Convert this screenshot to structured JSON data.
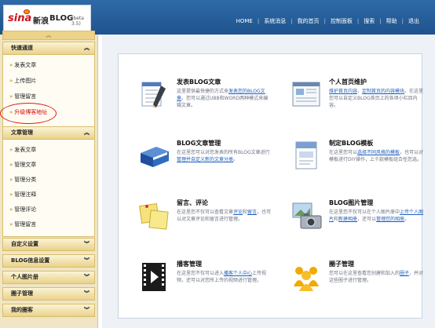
{
  "header": {
    "logo": {
      "sina": "sina",
      "xinlang": "新浪",
      "blog": "BLOG",
      "beta": "(beta 3.5)"
    },
    "nav": [
      "HOME",
      "系统消息",
      "我的首页",
      "控制面板",
      "搜索",
      "帮助",
      "退出"
    ]
  },
  "sidebar": {
    "collapse_glyph": "︽",
    "sections": [
      {
        "title": "快速通道",
        "items": [
          "发表文章",
          "上传图片",
          "管理留言",
          "升级博客地址"
        ]
      },
      {
        "title": "文章管理",
        "items": [
          "发表文章",
          "管理文章",
          "管理分类",
          "管理注释",
          "管理评论",
          "管理留言"
        ]
      },
      {
        "title": "自定义设置"
      },
      {
        "title": "BLOG信息设置"
      },
      {
        "title": "个人图片册"
      },
      {
        "title": "圈子管理"
      },
      {
        "title": "我的圈客"
      }
    ]
  },
  "features": [
    {
      "title": "发表BLOG文章",
      "desc_parts": [
        {
          "t": "这里提供最快捷的方式来"
        },
        {
          "t": "发表您的BLOG文章",
          "link": true
        },
        {
          "t": "。您可以通过UBB和WORD两种模式来编辑文章。"
        }
      ]
    },
    {
      "title": "个人首页维护",
      "desc_parts": [
        {
          "t": "维护首页内容",
          "link": true
        },
        {
          "t": "，"
        },
        {
          "t": "定制首页的内容模块",
          "link": true
        },
        {
          "t": "。在这里您可以自定义BLOG首页上的各项小栏目内容。"
        }
      ]
    },
    {
      "title": "BLOG文章管理",
      "desc_parts": [
        {
          "t": "在这里您可以对您发表的所有BLOG文章进行"
        },
        {
          "t": "管理并自定义新的文章分类",
          "link": true
        },
        {
          "t": "。"
        }
      ]
    },
    {
      "title": "制定BLOG模板",
      "desc_parts": [
        {
          "t": "在这里您可以"
        },
        {
          "t": "选择不同风格的模板",
          "link": true
        },
        {
          "t": "，也可以对模板进行DIY操作，上千款模板组合任您选。"
        }
      ]
    },
    {
      "title": "留言、评论",
      "desc_parts": [
        {
          "t": "在这里您不仅可以查看文章"
        },
        {
          "t": "评论",
          "link": true
        },
        {
          "t": "和"
        },
        {
          "t": "留言",
          "link": true
        },
        {
          "t": "，也可以对文章评论和留言进行管理。"
        }
      ]
    },
    {
      "title": "BLOG图片管理",
      "desc_parts": [
        {
          "t": "在这里您不仅可以在个人图片册中"
        },
        {
          "t": "上传个人图片",
          "link": true
        },
        {
          "t": "和"
        },
        {
          "t": "新建相册",
          "link": true
        },
        {
          "t": "，还可以"
        },
        {
          "t": "管理您的相册",
          "link": true
        },
        {
          "t": "。"
        }
      ]
    },
    {
      "title": "播客管理",
      "desc_parts": [
        {
          "t": "在这里您不仅可以进入"
        },
        {
          "t": "播客个人中心",
          "link": true
        },
        {
          "t": "上传视频，还可以对您所上传的视频进行管理。"
        }
      ]
    },
    {
      "title": "圈子管理",
      "desc_parts": [
        {
          "t": "您可以在这里查看您创建和加入的"
        },
        {
          "t": "圈子",
          "link": true
        },
        {
          "t": "，并对这些圈子进行管理。"
        }
      ]
    }
  ]
}
